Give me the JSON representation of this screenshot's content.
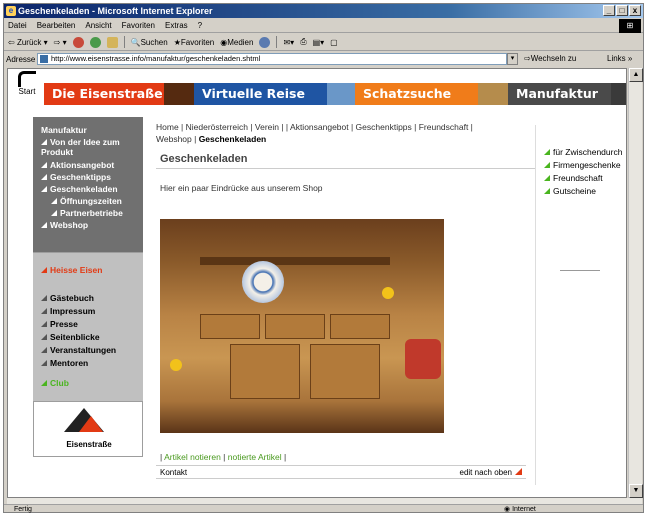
{
  "window": {
    "title": "Geschenkeladen - Microsoft Internet Explorer",
    "controls": [
      "_",
      "□",
      "x"
    ]
  },
  "menubar": {
    "items": [
      "Datei",
      "Bearbeiten",
      "Ansicht",
      "Favoriten",
      "Extras",
      "?"
    ]
  },
  "toolbar": {
    "back": "Zurück",
    "search": "Suchen",
    "favorites": "Favoriten",
    "media": "Medien"
  },
  "addressbar": {
    "label": "Adresse",
    "url": "http://www.eisenstrasse.info/manufaktur/geschenkeladen.shtml",
    "go": "Wechseln zu",
    "links": "Links »"
  },
  "banner": {
    "start": "Start",
    "bands": [
      "Die Eisenstraße",
      "Virtuelle Reise",
      "Schatzsuche",
      "Manufaktur"
    ]
  },
  "leftnav": {
    "header": "Manufaktur",
    "items": [
      {
        "label": "Von der Idee zum Produkt"
      },
      {
        "label": "Aktionsangebot"
      },
      {
        "label": "Geschenktipps"
      },
      {
        "label": "Geschenkeladen"
      },
      {
        "label": "Öffnungszeiten"
      },
      {
        "label": "Partnerbetriebe"
      },
      {
        "label": "Webshop"
      }
    ],
    "heisse": "Heisse Eisen",
    "secondary": [
      "Gästebuch",
      "Impressum",
      "Presse",
      "Seitenblicke",
      "Veranstaltungen",
      "Mentoren"
    ],
    "club": "Club",
    "logo_text": "Eisenstraße"
  },
  "breadcrumb": {
    "text": "Home | Niederösterreich | Verein | | Aktionsangebot | Geschenktipps | Freundschaft | Webshop | ",
    "current": "Geschenkeladen"
  },
  "main": {
    "title": "Geschenkeladen",
    "intro": "Hier ein paar Eindrücke aus unserem Shop",
    "artikel_notieren": "Artikel notieren",
    "notierte_artikel": "notierte Artikel",
    "footer_left": "Kontakt",
    "footer_right": "edit nach oben"
  },
  "rightcol": {
    "items": [
      "für Zwischendurch",
      "Firmengeschenke",
      "Freundschaft",
      "Gutscheine"
    ]
  },
  "statusbar": {
    "left": "Fertig",
    "zone": "Internet"
  },
  "colors": {
    "red": "#e23a14",
    "blue": "#1f55a3",
    "orange": "#f07c1a",
    "green": "#4ab51f",
    "navgray": "#707070"
  }
}
